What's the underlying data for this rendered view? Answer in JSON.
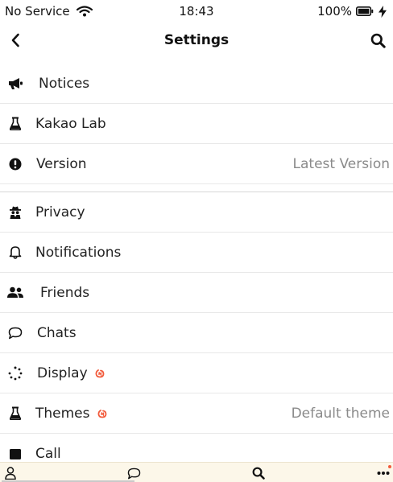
{
  "status": {
    "carrier": "No Service",
    "time": "18:43",
    "battery": "100%",
    "icons": [
      "wifi-icon",
      "battery-icon",
      "charging-bolt-icon"
    ]
  },
  "nav": {
    "title": "Settings",
    "icons": [
      "back-chevron-icon",
      "search-icon"
    ]
  },
  "sections": [
    {
      "items": [
        {
          "label": "Notices",
          "icon": "megaphone-icon"
        },
        {
          "label": "Kakao Lab",
          "icon": "flask-icon"
        },
        {
          "label": "Version",
          "icon": "exclamation-circle-icon",
          "value": "Latest Version"
        }
      ]
    },
    {
      "items": [
        {
          "label": "Privacy",
          "icon": "spy-icon"
        },
        {
          "label": "Notifications",
          "icon": "bell-icon"
        },
        {
          "label": "Friends",
          "icon": "users-icon"
        },
        {
          "label": "Chats",
          "icon": "chat-bubble-icon"
        },
        {
          "label": "Display",
          "icon": "spinner-dots-icon",
          "badge": "new-badge-icon"
        },
        {
          "label": "Themes",
          "icon": "flask-icon",
          "badge": "new-badge-icon",
          "value": "Default theme"
        },
        {
          "label": "Call",
          "icon": "call-icon"
        }
      ]
    }
  ],
  "tabbar": {
    "tabs": [
      {
        "icon": "person-icon"
      },
      {
        "icon": "chat-bubble-icon"
      },
      {
        "icon": "search-icon"
      },
      {
        "icon": "more-dots-icon"
      }
    ]
  },
  "colors": {
    "tabbar_bg": "#fcf7e9",
    "badge": "#f25b3c",
    "value_text": "#8a8a8a",
    "divider": "#e8e8e8"
  }
}
